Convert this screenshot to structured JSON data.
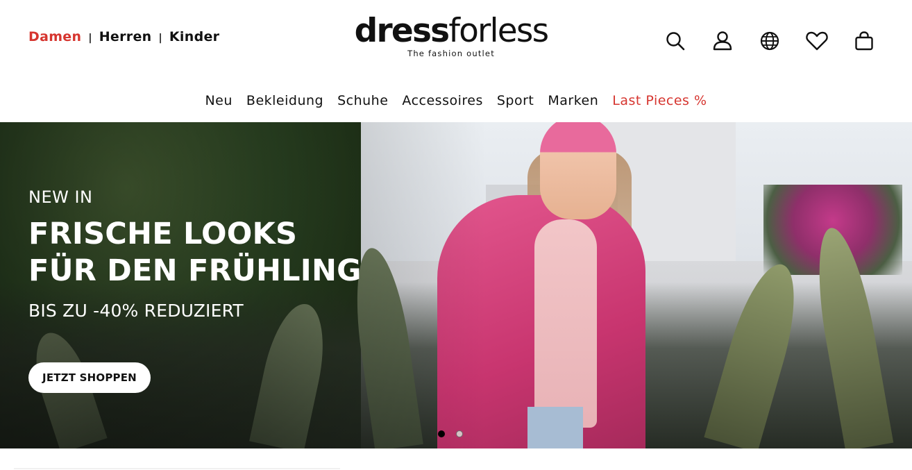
{
  "header": {
    "gender_tabs": [
      {
        "label": "Damen",
        "active": true
      },
      {
        "label": "Herren",
        "active": false
      },
      {
        "label": "Kinder",
        "active": false
      }
    ],
    "separator": "|",
    "logo": {
      "bold": "dress",
      "light": "forless",
      "tagline": "The fashion outlet"
    },
    "icons": [
      "search-icon",
      "account-icon",
      "language-icon",
      "wishlist-icon",
      "cart-icon"
    ]
  },
  "nav": {
    "items": [
      "Neu",
      "Bekleidung",
      "Schuhe",
      "Accessoires",
      "Sport",
      "Marken"
    ],
    "sale_item": "Last Pieces %"
  },
  "hero": {
    "kicker": "NEW IN",
    "headline_line1": "FRISCHE LOOKS",
    "headline_line2": "FÜR DEN FRÜHLING",
    "subline": "BIS ZU -40% REDUZIERT",
    "cta": "JETZT SHOPPEN",
    "slides_total": 2,
    "active_slide": 1
  },
  "colors": {
    "accent": "#d6352f",
    "text": "#111111",
    "cta_bg": "#ffffff"
  }
}
